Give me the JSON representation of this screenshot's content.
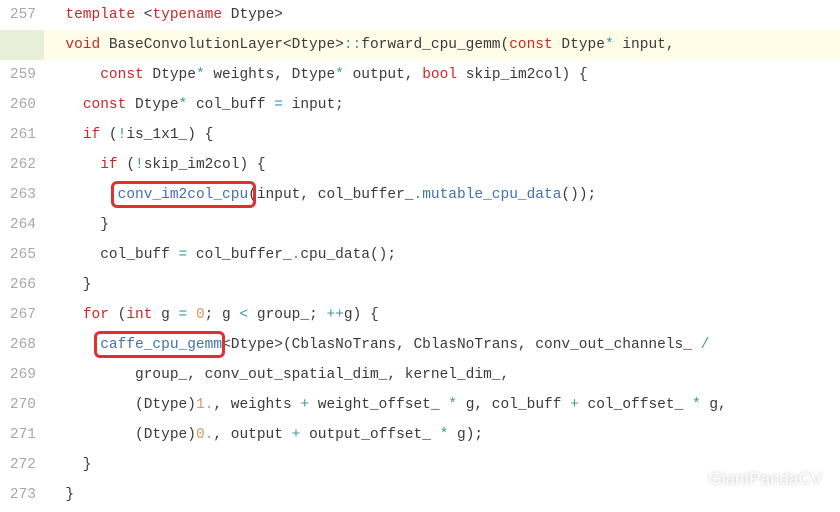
{
  "gutter": {
    "start": 257,
    "end": 273
  },
  "highlighted_line_no": 258,
  "callouts": [
    {
      "id": "box1",
      "name": "callout-conv-im2col-cpu"
    },
    {
      "id": "box2",
      "name": "callout-caffe-cpu-gemm"
    }
  ],
  "tokens": {
    "257": [
      {
        "t": "  ",
        "c": ""
      },
      {
        "t": "template",
        "c": "kw-red"
      },
      {
        "t": " <",
        "c": "id-plain"
      },
      {
        "t": "typename",
        "c": "kw-red"
      },
      {
        "t": " Dtype>",
        "c": "id-plain"
      }
    ],
    "258": [
      {
        "t": "  ",
        "c": ""
      },
      {
        "t": "void",
        "c": "kw-red"
      },
      {
        "t": " BaseConvolutionLayer<Dtype>",
        "c": "id-plain"
      },
      {
        "t": "::",
        "c": "kw-teal"
      },
      {
        "t": "forward_cpu_gemm(",
        "c": "id-plain"
      },
      {
        "t": "const",
        "c": "kw-red"
      },
      {
        "t": " Dtype",
        "c": "id-plain"
      },
      {
        "t": "*",
        "c": "kw-teal"
      },
      {
        "t": " input,",
        "c": "id-plain"
      }
    ],
    "259": [
      {
        "t": "      ",
        "c": ""
      },
      {
        "t": "const",
        "c": "kw-red"
      },
      {
        "t": " Dtype",
        "c": "id-plain"
      },
      {
        "t": "*",
        "c": "kw-teal"
      },
      {
        "t": " weights, Dtype",
        "c": "id-plain"
      },
      {
        "t": "*",
        "c": "kw-teal"
      },
      {
        "t": " output, ",
        "c": "id-plain"
      },
      {
        "t": "bool",
        "c": "kw-red"
      },
      {
        "t": " skip_im2col) {",
        "c": "id-plain"
      }
    ],
    "260": [
      {
        "t": "    ",
        "c": ""
      },
      {
        "t": "const",
        "c": "kw-red"
      },
      {
        "t": " Dtype",
        "c": "id-plain"
      },
      {
        "t": "*",
        "c": "kw-teal"
      },
      {
        "t": " col_buff ",
        "c": "id-plain"
      },
      {
        "t": "=",
        "c": "kw-teal"
      },
      {
        "t": " input;",
        "c": "id-plain"
      }
    ],
    "261": [
      {
        "t": "    ",
        "c": ""
      },
      {
        "t": "if",
        "c": "kw-red"
      },
      {
        "t": " (",
        "c": "id-plain"
      },
      {
        "t": "!",
        "c": "kw-teal"
      },
      {
        "t": "is_1x1_) {",
        "c": "id-plain"
      }
    ],
    "262": [
      {
        "t": "      ",
        "c": ""
      },
      {
        "t": "if",
        "c": "kw-red"
      },
      {
        "t": " (",
        "c": "id-plain"
      },
      {
        "t": "!",
        "c": "kw-teal"
      },
      {
        "t": "skip_im2col) {",
        "c": "id-plain"
      }
    ],
    "263": [
      {
        "t": "        ",
        "c": ""
      },
      {
        "t": "conv_im2col_cpu",
        "c": "kw-link"
      },
      {
        "t": "(input, col_buffer_",
        "c": "id-plain"
      },
      {
        "t": ".",
        "c": "kw-teal"
      },
      {
        "t": "mutable_cpu_data",
        "c": "kw-link"
      },
      {
        "t": "());",
        "c": "id-plain"
      }
    ],
    "264": [
      {
        "t": "      }",
        "c": "id-plain"
      }
    ],
    "265": [
      {
        "t": "      col_buff ",
        "c": "id-plain"
      },
      {
        "t": "=",
        "c": "kw-teal"
      },
      {
        "t": " col_buffer_",
        "c": "id-plain"
      },
      {
        "t": ".",
        "c": "kw-teal"
      },
      {
        "t": "cpu_data();",
        "c": "id-plain"
      }
    ],
    "266": [
      {
        "t": "    }",
        "c": "id-plain"
      }
    ],
    "267": [
      {
        "t": "    ",
        "c": ""
      },
      {
        "t": "for",
        "c": "kw-red"
      },
      {
        "t": " (",
        "c": "id-plain"
      },
      {
        "t": "int",
        "c": "kw-red"
      },
      {
        "t": " g ",
        "c": "id-plain"
      },
      {
        "t": "=",
        "c": "kw-teal"
      },
      {
        "t": " ",
        "c": ""
      },
      {
        "t": "0",
        "c": "num"
      },
      {
        "t": "; g ",
        "c": "id-plain"
      },
      {
        "t": "<",
        "c": "kw-teal"
      },
      {
        "t": " group_; ",
        "c": "id-plain"
      },
      {
        "t": "++",
        "c": "kw-teal"
      },
      {
        "t": "g) {",
        "c": "id-plain"
      }
    ],
    "268": [
      {
        "t": "      ",
        "c": ""
      },
      {
        "t": "caffe_cpu_gemm",
        "c": "kw-link"
      },
      {
        "t": "<Dtype>(CblasNoTrans, CblasNoTrans, conv_out_channels_ ",
        "c": "id-plain"
      },
      {
        "t": "/",
        "c": "kw-teal"
      }
    ],
    "269": [
      {
        "t": "          group_, conv_out_spatial_dim_, kernel_dim_,",
        "c": "id-plain"
      }
    ],
    "270": [
      {
        "t": "          (Dtype)",
        "c": "id-plain"
      },
      {
        "t": "1.",
        "c": "num"
      },
      {
        "t": ", weights ",
        "c": "id-plain"
      },
      {
        "t": "+",
        "c": "kw-teal"
      },
      {
        "t": " weight_offset_ ",
        "c": "id-plain"
      },
      {
        "t": "*",
        "c": "kw-teal"
      },
      {
        "t": " g, col_buff ",
        "c": "id-plain"
      },
      {
        "t": "+",
        "c": "kw-teal"
      },
      {
        "t": " col_offset_ ",
        "c": "id-plain"
      },
      {
        "t": "*",
        "c": "kw-teal"
      },
      {
        "t": " g,",
        "c": "id-plain"
      }
    ],
    "271": [
      {
        "t": "          (Dtype)",
        "c": "id-plain"
      },
      {
        "t": "0.",
        "c": "num"
      },
      {
        "t": ", output ",
        "c": "id-plain"
      },
      {
        "t": "+",
        "c": "kw-teal"
      },
      {
        "t": " output_offset_ ",
        "c": "id-plain"
      },
      {
        "t": "*",
        "c": "kw-teal"
      },
      {
        "t": " g);",
        "c": "id-plain"
      }
    ],
    "272": [
      {
        "t": "    }",
        "c": "id-plain"
      }
    ],
    "273": [
      {
        "t": "  }",
        "c": "id-plain"
      }
    ]
  },
  "watermark": {
    "text": "GiantPandaCV",
    "icon": "wechat-icon"
  }
}
